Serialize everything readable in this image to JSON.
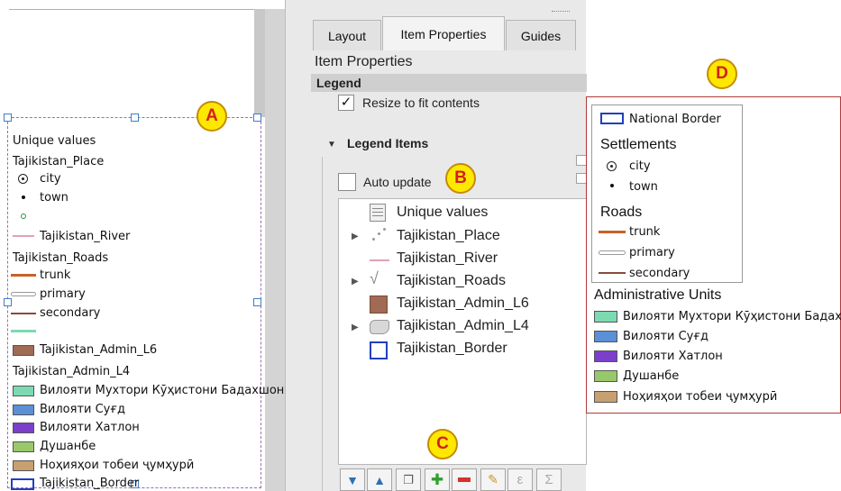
{
  "badges": {
    "a": "A",
    "b": "B",
    "c": "C",
    "d": "D"
  },
  "canvas_legend": {
    "heading": "Unique values",
    "place_layer": "Tajikistan_Place",
    "place_items": [
      "city",
      "town"
    ],
    "river_layer": "Tajikistan_River",
    "roads_layer": "Tajikistan_Roads",
    "roads_items": [
      "trunk",
      "primary",
      "secondary"
    ],
    "admin6_layer": "Tajikistan_Admin_L6",
    "admin4_layer": "Tajikistan_Admin_L4",
    "admin4_items": [
      "Вилояти Мухтори Кӯҳистони Бадахшон",
      "Вилояти Суғд",
      "Вилояти Хатлон",
      "Душанбе",
      "Ноҳияҳои тобеи ҷумҳурӣ"
    ],
    "border_layer": "Tajikistan_Border"
  },
  "props": {
    "tabs": [
      "Layout",
      "Item Properties",
      "Guides"
    ],
    "panel_title": "Item Properties",
    "section": "Legend",
    "resize_label": "Resize to fit contents",
    "legend_items_label": "Legend Items",
    "auto_update_label": "Auto update",
    "tree": [
      "Unique values",
      "Tajikistan_Place",
      "Tajikistan_River",
      "Tajikistan_Roads",
      "Tajikistan_Admin_L6",
      "Tajikistan_Admin_L4",
      "Tajikistan_Border"
    ]
  },
  "print_legend": {
    "national_border": "National Border",
    "settlements_title": "Settlements",
    "settlements": [
      "city",
      "town"
    ],
    "roads_title": "Roads",
    "roads": [
      "trunk",
      "primary",
      "secondary"
    ],
    "admin_title": "Administrative Units",
    "admin": [
      "Вилояти Мухтори Кӯҳистони Бадахшон",
      "Вилояти Суғд",
      "Вилояти Хатлон",
      "Душанбе",
      "Ноҳияҳои тобеи ҷумҳурӣ"
    ]
  },
  "colors": {
    "admin_colors": [
      "#7dd9b2",
      "#5b8fd6",
      "#7b3fcb",
      "#98c86a",
      "#c8a070"
    ],
    "admin6": "#a06a55",
    "trunk": "#c8622a",
    "secondary": "#8a4a3a",
    "river": "#e0a0b8",
    "border": "#2040c0",
    "badge": "#ffe800"
  }
}
